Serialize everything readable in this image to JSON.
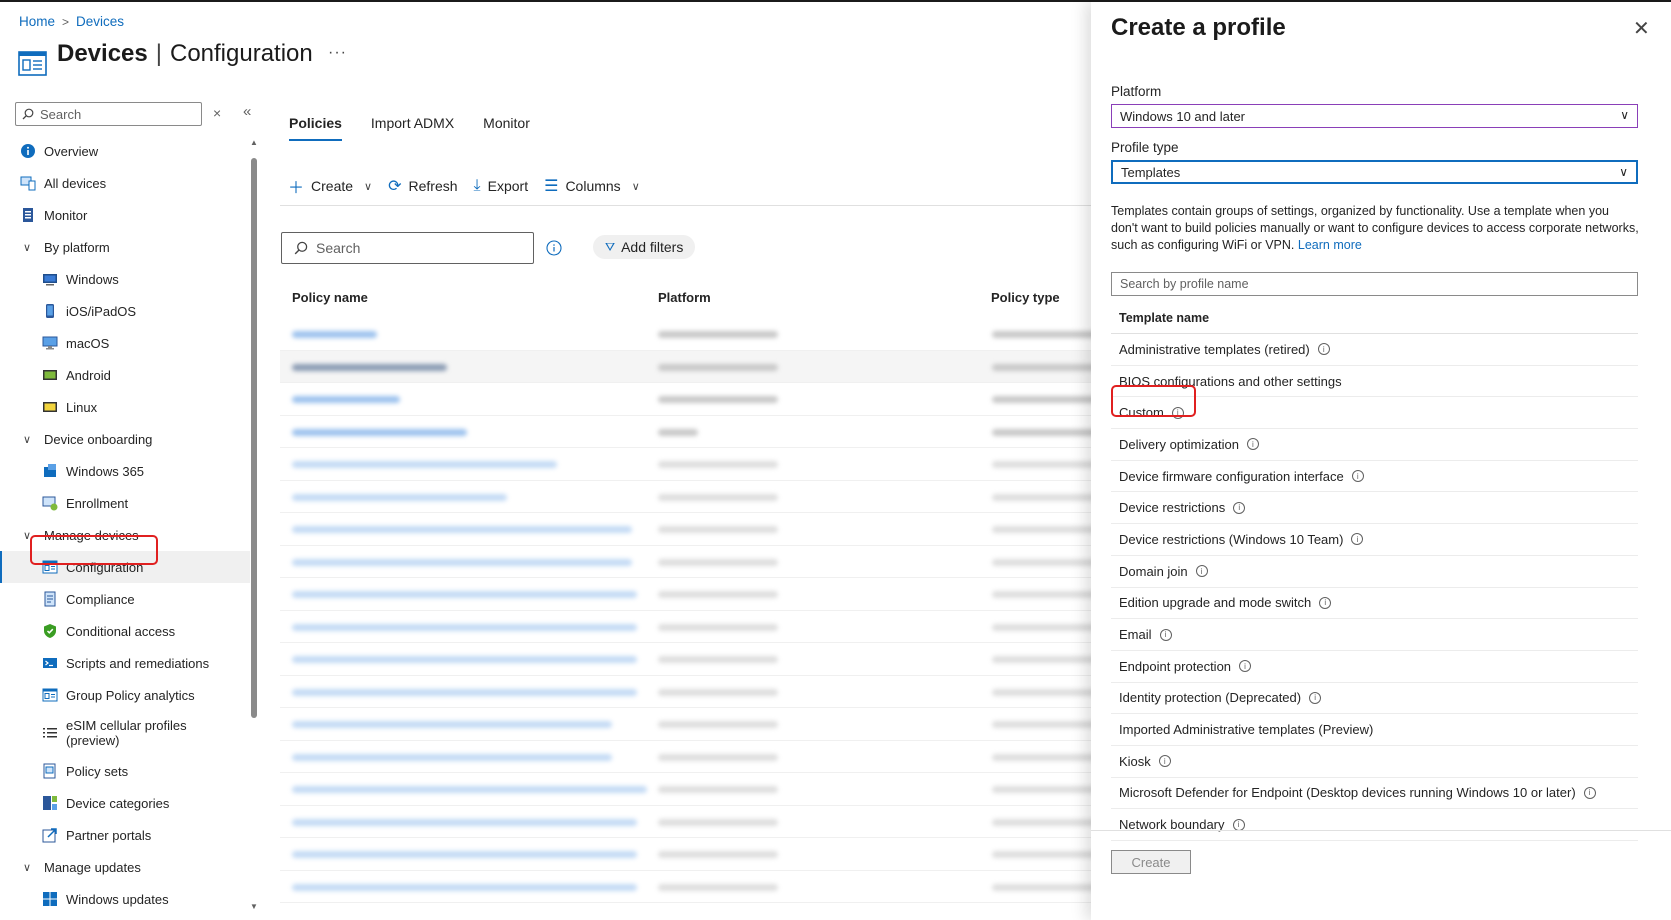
{
  "breadcrumb": {
    "home": "Home",
    "sep": ">",
    "devices": "Devices"
  },
  "page": {
    "title_main": "Devices",
    "title_sep": "|",
    "title_sub": "Configuration",
    "more": "···"
  },
  "sidebar": {
    "search_placeholder": "Search",
    "clear": "×",
    "collapse": "«",
    "items": [
      {
        "label": "Overview",
        "icon": "info-icon"
      },
      {
        "label": "All devices",
        "icon": "devices-icon"
      },
      {
        "label": "Monitor",
        "icon": "monitor-icon"
      },
      {
        "label": "By platform",
        "group": true
      },
      {
        "label": "Windows",
        "icon": "windows-device-icon"
      },
      {
        "label": "iOS/iPadOS",
        "icon": "phone-icon"
      },
      {
        "label": "macOS",
        "icon": "desktop-icon"
      },
      {
        "label": "Android",
        "icon": "android-icon"
      },
      {
        "label": "Linux",
        "icon": "linux-icon"
      },
      {
        "label": "Device onboarding",
        "group": true
      },
      {
        "label": "Windows 365",
        "icon": "windows-365-icon"
      },
      {
        "label": "Enrollment",
        "icon": "enrollment-icon"
      },
      {
        "label": "Manage devices",
        "group": true
      },
      {
        "label": "Configuration",
        "icon": "configuration-icon",
        "selected": true
      },
      {
        "label": "Compliance",
        "icon": "compliance-icon"
      },
      {
        "label": "Conditional access",
        "icon": "shield-icon"
      },
      {
        "label": "Scripts and remediations",
        "icon": "scripts-icon"
      },
      {
        "label": "Group Policy analytics",
        "icon": "analytics-icon"
      },
      {
        "label": "eSIM cellular profiles (preview)",
        "icon": "esim-icon"
      },
      {
        "label": "Policy sets",
        "icon": "policy-sets-icon"
      },
      {
        "label": "Device categories",
        "icon": "categories-icon"
      },
      {
        "label": "Partner portals",
        "icon": "partner-portal-icon"
      },
      {
        "label": "Manage updates",
        "group": true
      },
      {
        "label": "Windows updates",
        "icon": "windows-logo-icon"
      }
    ]
  },
  "tabs": [
    "Policies",
    "Import ADMX",
    "Monitor"
  ],
  "toolbar": {
    "create": "Create",
    "refresh": "Refresh",
    "export": "Export",
    "columns": "Columns"
  },
  "main": {
    "search_placeholder": "Search",
    "add_filters": "Add filters",
    "columns": [
      "Policy name",
      "Platform",
      "Policy type"
    ]
  },
  "panel": {
    "title": "Create a profile",
    "close": "✕",
    "platform_label": "Platform",
    "platform_value": "Windows 10 and later",
    "profile_type_label": "Profile type",
    "profile_type_value": "Templates",
    "description": "Templates contain groups of settings, organized by functionality. Use a template when you don't want to build policies manually or want to configure devices to access corporate networks, such as configuring WiFi or VPN.",
    "learn_more": "Learn more",
    "search_placeholder": "Search by profile name",
    "template_header": "Template name",
    "templates": [
      {
        "name": "Administrative templates (retired)",
        "info": true
      },
      {
        "name": "BIOS configurations and other settings",
        "info": false
      },
      {
        "name": "Custom",
        "info": true
      },
      {
        "name": "Delivery optimization",
        "info": true
      },
      {
        "name": "Device firmware configuration interface",
        "info": true
      },
      {
        "name": "Device restrictions",
        "info": true
      },
      {
        "name": "Device restrictions (Windows 10 Team)",
        "info": true
      },
      {
        "name": "Domain join",
        "info": true
      },
      {
        "name": "Edition upgrade and mode switch",
        "info": true
      },
      {
        "name": "Email",
        "info": true
      },
      {
        "name": "Endpoint protection",
        "info": true
      },
      {
        "name": "Identity protection (Deprecated)",
        "info": true
      },
      {
        "name": "Imported Administrative templates (Preview)",
        "info": false
      },
      {
        "name": "Kiosk",
        "info": true
      },
      {
        "name": "Microsoft Defender for Endpoint (Desktop devices running Windows 10 or later)",
        "info": true
      },
      {
        "name": "Network boundary",
        "info": true
      }
    ],
    "create_button": "Create"
  },
  "colors": {
    "accent": "#0f6cbd",
    "highlight_box": "#e02020",
    "platform_border": "#8a3fb8"
  }
}
